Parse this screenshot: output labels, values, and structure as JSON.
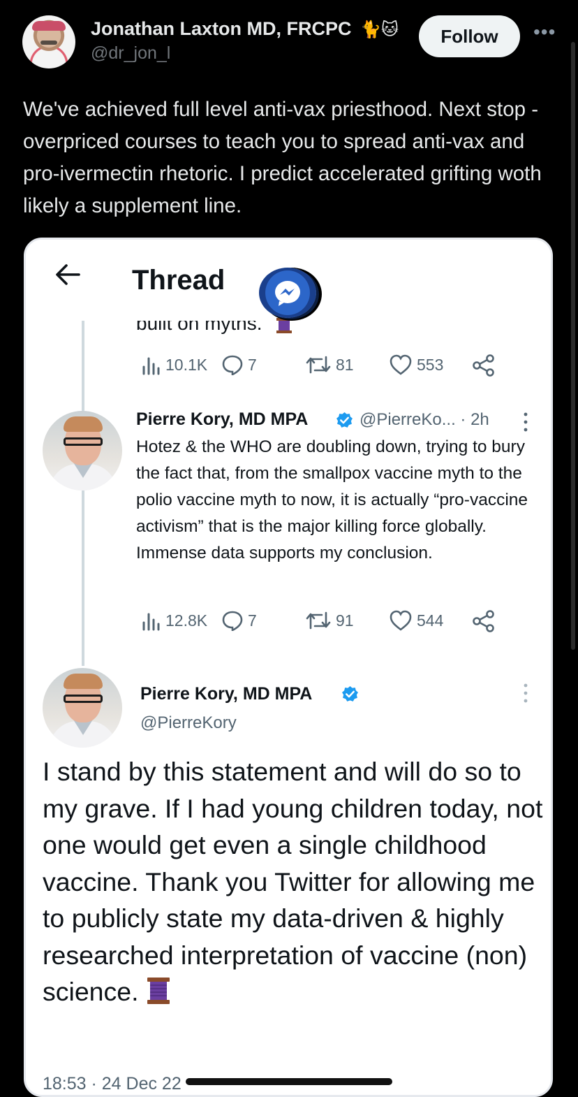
{
  "author": {
    "name": "Jonathan Laxton MD, FRCPC",
    "emoji": "🐈🐱",
    "handle": "@dr_jon_l",
    "follow_label": "Follow",
    "more_icon": "ellipsis-icon"
  },
  "tweet": {
    "text": "We've achieved full level anti-vax priesthood.  Next stop - overpriced courses to teach you to spread anti-vax and pro-ivermectin rhetoric. I predict accelerated grifting woth likely a supplement line."
  },
  "embedded": {
    "header_title": "Thread",
    "cut_off_text": "built on myths.",
    "first_stats": {
      "views": "10.1K",
      "replies": "7",
      "retweets": "81",
      "likes": "553"
    },
    "reply": {
      "name": "Pierre Kory, MD MPA",
      "handle_time": "@PierreKo... · 2h",
      "text": "Hotez & the WHO are doubling down, trying to bury the fact that, from the smallpox vaccine myth to the polio vaccine myth to now, it is actually “pro-vaccine activism” that is the major killing force globally. Immense data supports my conclusion.",
      "stats": {
        "views": "12.8K",
        "replies": "7",
        "retweets": "91",
        "likes": "544"
      }
    },
    "main": {
      "name": "Pierre Kory, MD MPA",
      "handle": "@PierreKory",
      "text": "I stand by this statement and will do so to my grave. If I had young children today, not one would get even a single childhood vaccine. Thank you Twitter for allowing me to publicly state my data-driven & highly researched interpretation of vaccine (non) science.",
      "timestamp": "18:53 · 24 Dec 22"
    },
    "colors": {
      "verified": "#1d9bf0",
      "spool": "#6b3fa0"
    }
  }
}
